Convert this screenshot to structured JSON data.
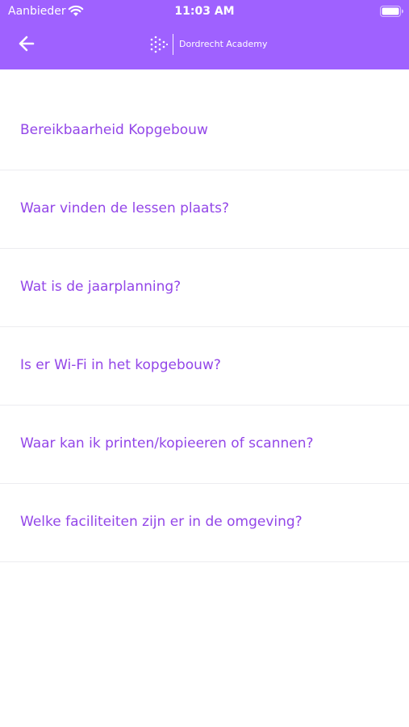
{
  "status_bar": {
    "carrier": "Aanbieder",
    "time": "11:03 AM",
    "wifi_icon": "wifi-icon",
    "battery_icon": "battery-icon"
  },
  "header": {
    "back_icon": "back-arrow-icon",
    "brand_name": "Dordrecht Academy",
    "background_color": "#9F61FF"
  },
  "faq": {
    "text_color": "#9346E8",
    "items": [
      {
        "label": "Bereikbaarheid Kopgebouw"
      },
      {
        "label": "Waar vinden de lessen plaats?"
      },
      {
        "label": "Wat is de jaarplanning?"
      },
      {
        "label": "Is er Wi-Fi in het kopgebouw?"
      },
      {
        "label": "Waar kan ik printen/kopieeren of scannen?"
      },
      {
        "label": "Welke faciliteiten zijn er in de omgeving?"
      }
    ]
  }
}
